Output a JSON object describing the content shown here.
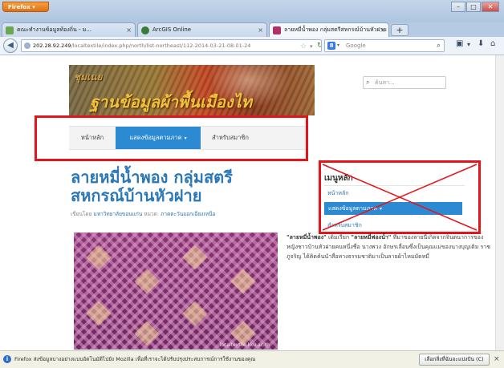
{
  "browser": {
    "firefox_label": "Firefox",
    "tabs": [
      {
        "label": "คณะทำงานข้อมูลท้องถิ่น - ม...",
        "icon": "puzzle-icon"
      },
      {
        "label": "ArcGIS Online",
        "icon": "globe-icon"
      },
      {
        "label": "ลายหมี่น้ำพอง กลุ่มสตรีสหกรณ์บ้านหัวฝาย",
        "icon": "site-favicon"
      }
    ],
    "new_tab": "+",
    "url_host": "202.28.92.249",
    "url_path": "/localtextile/index.php/north/list-northeast/112-2014-03-21-08-01-24",
    "search_engine_placeholder": "Google",
    "colors": {
      "accent": "#2b8ad1",
      "highlight": "#e3151a"
    }
  },
  "site": {
    "logo_text": "ชุมเนย",
    "banner_title": "ฐานข้อมูลผ้าพื้นเมืองไท",
    "search_placeholder": "ค้นหา...",
    "menu": [
      {
        "label": "หน้าหลัก",
        "active": false
      },
      {
        "label": "แสดงข้อมูลตามภาค",
        "active": true,
        "dropdown": true
      },
      {
        "label": "สำหรับสมาชิก",
        "active": false
      }
    ],
    "caret": "▾"
  },
  "article": {
    "title_line1": "ลายหมี่น้ำพอง กลุ่มสตรี",
    "title_line2": "สหกรณ์บ้านหัวฝาย",
    "byline_prefix": "เขียนโดย",
    "author": "มหาวิทยาลัยขอนแก่น",
    "category_prefix": "หมวด:",
    "category": "ภาคตะวันออกเฉียงเหนือ",
    "photo_watermark": "localtextile.kku.ac.th",
    "body_q1": "\"ลายหมี่น้ำพอง\"",
    "body_t1": " เดิมเรียก ",
    "body_q2": "\"ลายหมี่ฟองน้ำ\"",
    "body_t2": " ที่มาของลายนี้เกิดจากจินตนาการของหญิงชาวบ้านหัวฝายคนหนึ่งชื่อ นางพวง อักษรเลื่อนซึ่งเป็นคุณแม่ของนางบุญเติม ราชภูจริญ ได้คิดค้นนำสื่อทางธรรมชาติมาเป็นลายผ้าไหมมัดหมี่"
  },
  "sidebar": {
    "heading": "เมนูหลัก",
    "items": [
      {
        "label": "หน้าหลัก"
      },
      {
        "label": "แสดงข้อมูลตามภาค"
      },
      {
        "label": "สำหรับสมาชิก"
      }
    ]
  },
  "notification": {
    "text": "Firefox ส่งข้อมูลบางอย่างแบบอัตโนมัติไปยัง Mozilla เพื่อที่เราจะได้ปรับปรุงประสบการณ์การใช้งานของคุณ",
    "button": "เลือกสิ่งที่ฉันจะแบ่งปัน (C)",
    "close": "×"
  }
}
